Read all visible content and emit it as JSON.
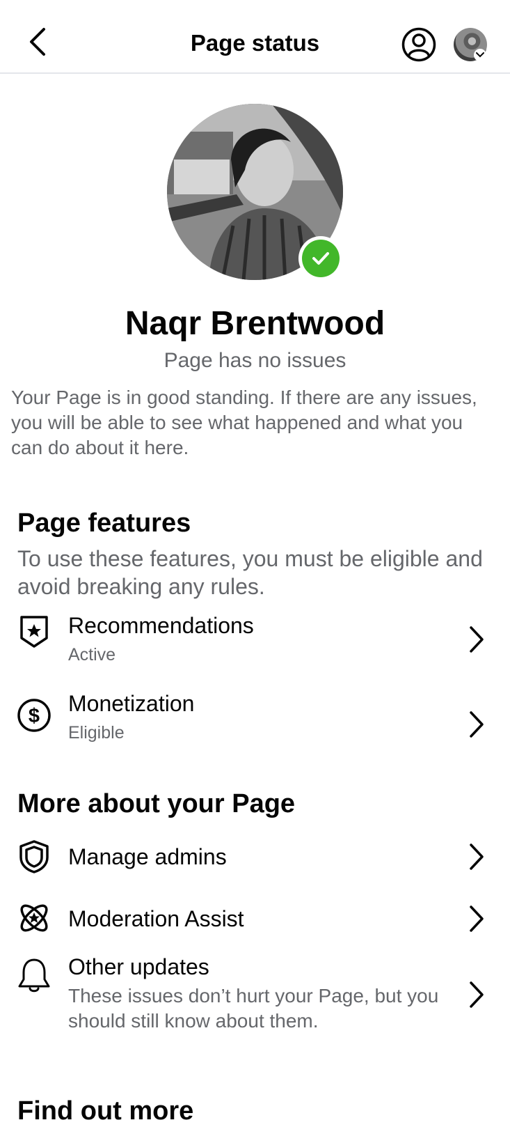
{
  "header": {
    "title": "Page status",
    "back_icon": "chevron-left-icon",
    "profile_icon": "profile-circle-icon"
  },
  "hero": {
    "page_name": "Naqr Brentwood",
    "status": "Page has no issues",
    "description": "Your Page is in good standing. If there are any issues, you will be able to see what happened and what you can do about it here.",
    "badge_color": "#42b72a"
  },
  "features": {
    "title": "Page features",
    "subtitle": "To use these features, you must be eligible and avoid breaking any rules.",
    "items": [
      {
        "label": "Recommendations",
        "status": "Active",
        "icon": "shield-star-icon"
      },
      {
        "label": "Monetization",
        "status": "Eligible",
        "icon": "dollar-circle-icon"
      }
    ]
  },
  "more": {
    "title": "More about your Page",
    "items": [
      {
        "label": "Manage admins",
        "icon": "shield-icon"
      },
      {
        "label": "Moderation Assist",
        "icon": "atom-star-icon"
      },
      {
        "label": "Other updates",
        "description": "These issues don’t hurt your Page, but you should still know about them.",
        "icon": "bell-icon"
      }
    ]
  },
  "find_out_more": {
    "title": "Find out more"
  },
  "colors": {
    "text_primary": "#050505",
    "text_secondary": "#65676b",
    "divider": "#e4e6eb"
  }
}
